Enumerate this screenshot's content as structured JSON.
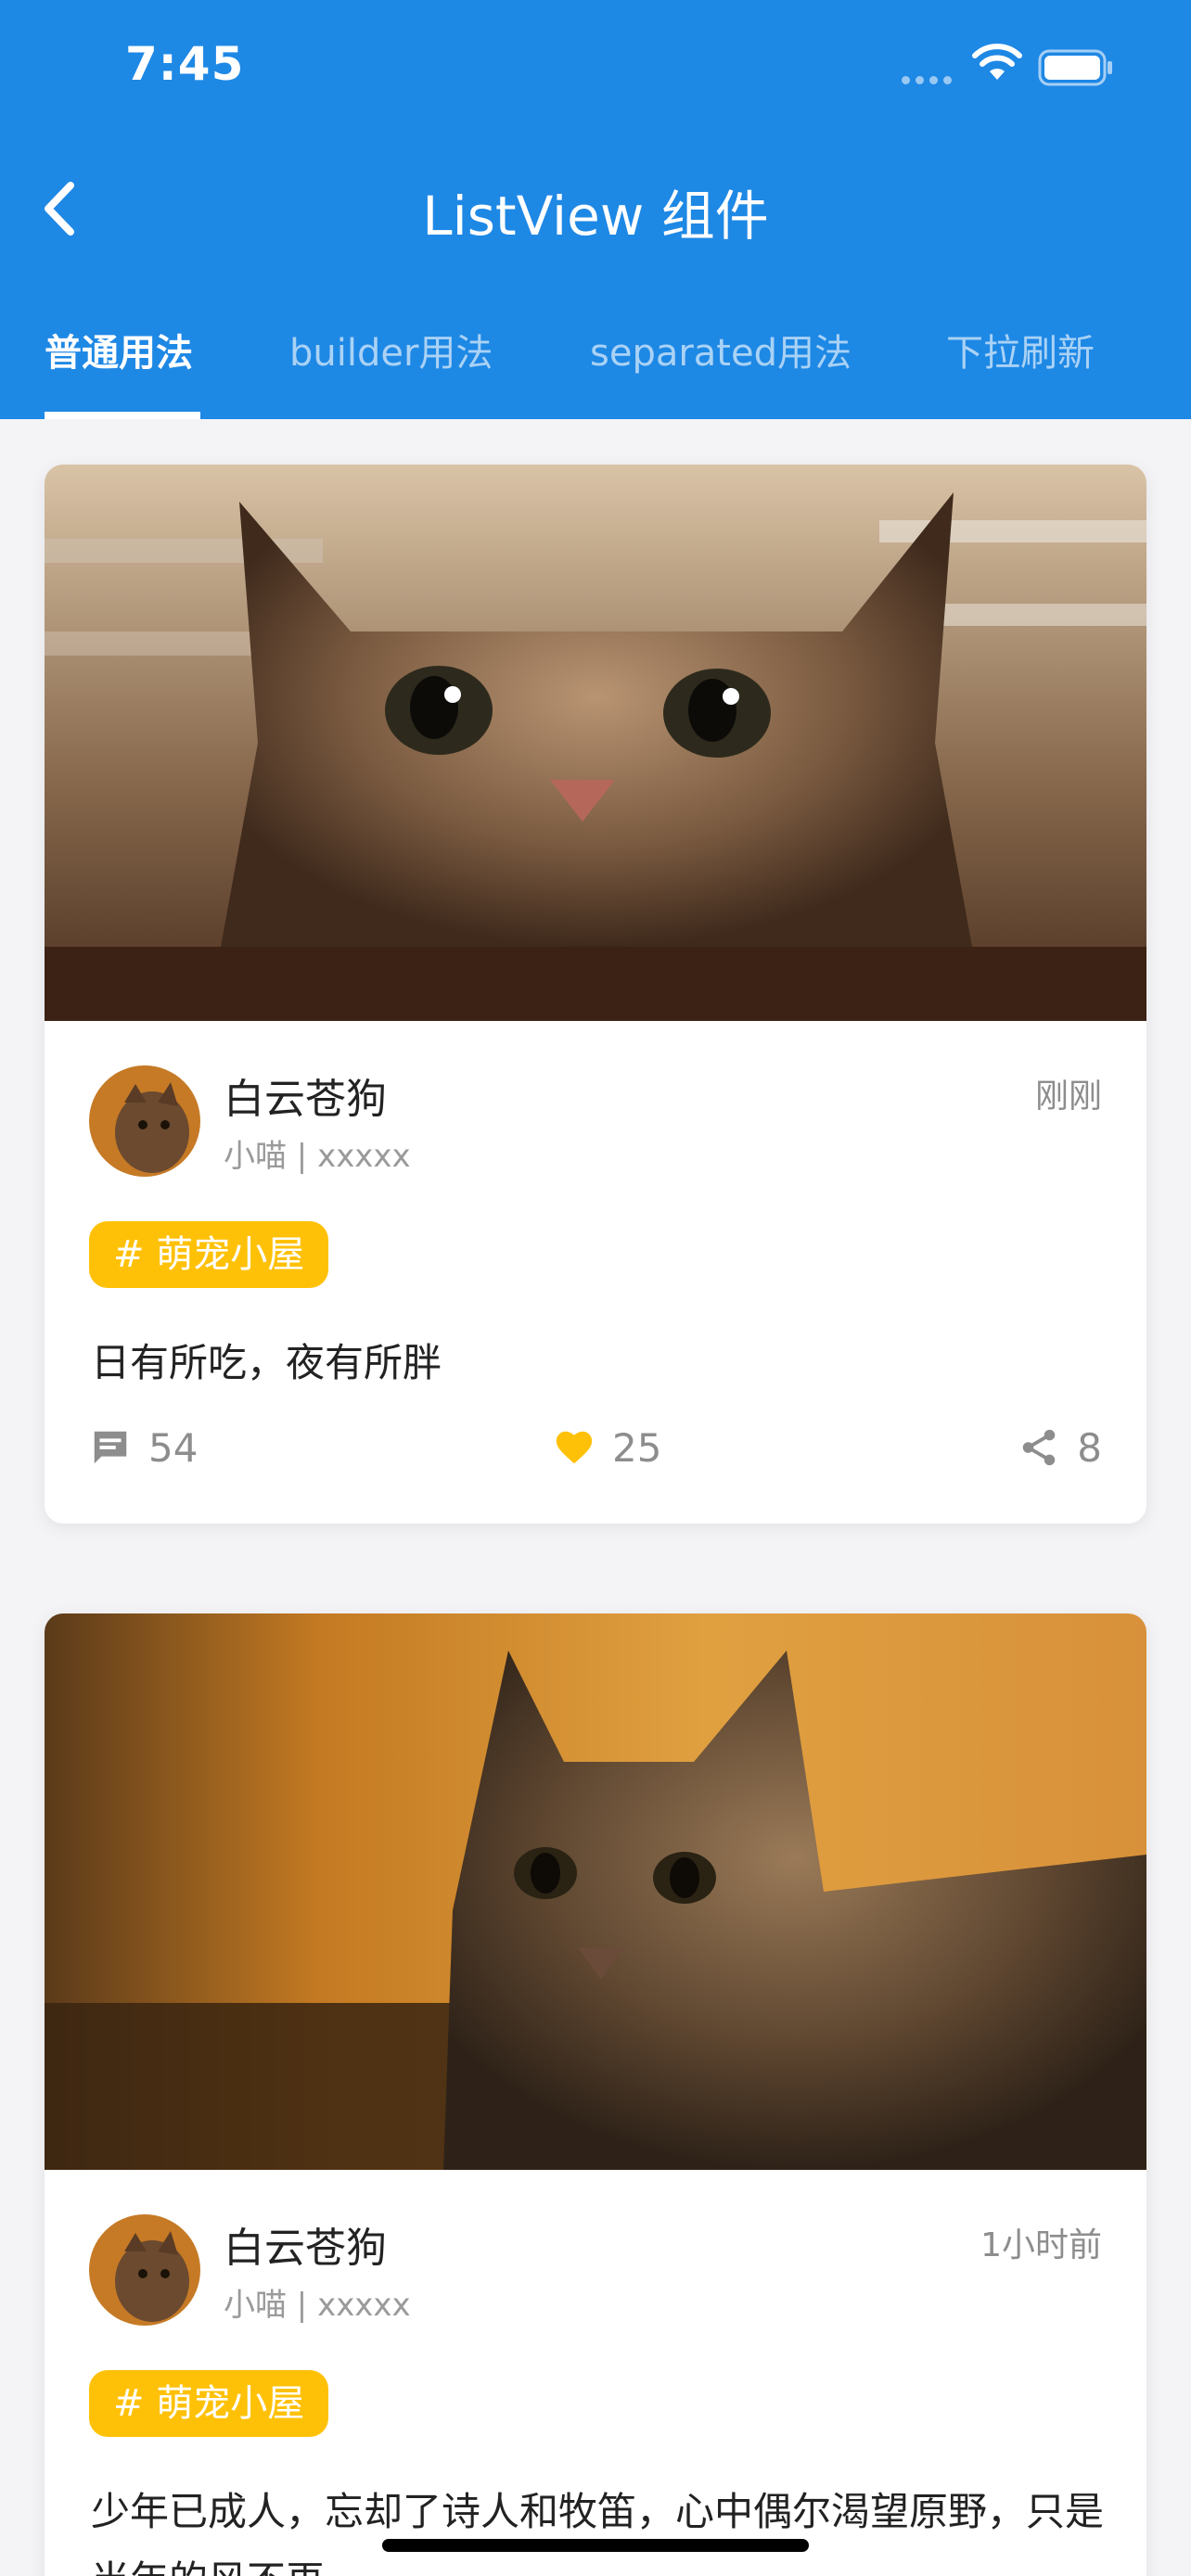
{
  "status_bar": {
    "time": "7:45"
  },
  "nav": {
    "title": "ListView 组件"
  },
  "tabs": [
    {
      "label": "普通用法",
      "active": true
    },
    {
      "label": "builder用法",
      "active": false
    },
    {
      "label": "separated用法",
      "active": false
    },
    {
      "label": "下拉刷新",
      "active": false
    }
  ],
  "posts": [
    {
      "author": "白云苍狗",
      "meta": "小喵 | xxxxx",
      "time": "刚刚",
      "tag": "# 萌宠小屋",
      "content": "日有所吃，夜有所胖",
      "comments": "54",
      "likes": "25",
      "shares": "8"
    },
    {
      "author": "白云苍狗",
      "meta": "小喵 | xxxxx",
      "time": "1小时前",
      "tag": "# 萌宠小屋",
      "content": "少年已成人，忘却了诗人和牧笛，心中偶尔渴望原野，只是当年的风不再"
    }
  ],
  "colors": {
    "primary": "#1e88e5",
    "tag": "#ffc107",
    "like": "#ffc107"
  },
  "icons": [
    "back-arrow-icon",
    "comment-icon",
    "heart-icon",
    "share-icon",
    "wifi-icon",
    "battery-icon"
  ]
}
